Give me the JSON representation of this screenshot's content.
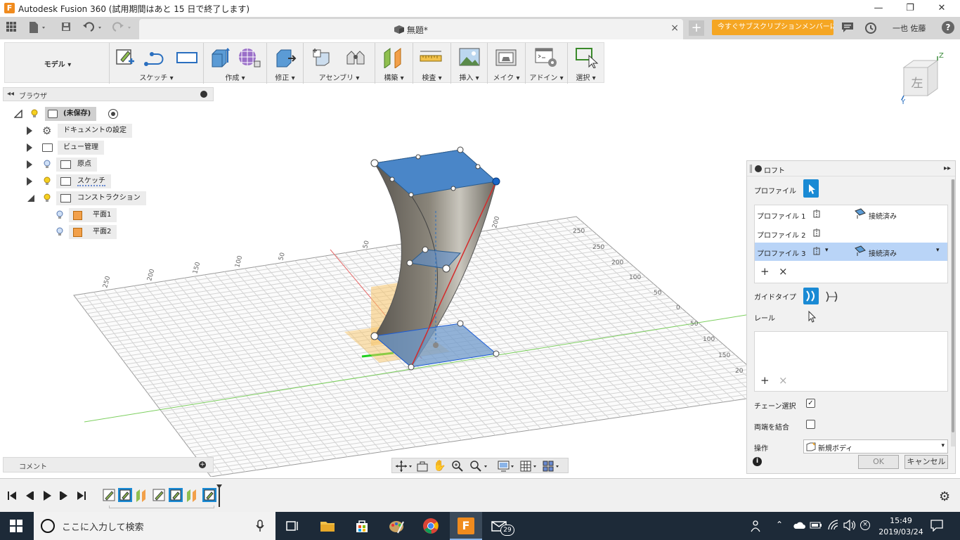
{
  "window": {
    "title": "Autodesk Fusion 360 (試用期間はあと 15 日で終了します)",
    "controls": [
      "—",
      "❐",
      "✕"
    ]
  },
  "tabbar": {
    "doc_title": "無題*",
    "close_glyph": "×",
    "new_tab_glyph": "+",
    "subscription_button": "今すぐサブスクリプションメンバーに...",
    "user_name": "一也 佐藤",
    "help_glyph": "?"
  },
  "toolbar": {
    "mode": "モデル",
    "groups": [
      {
        "label": "スケッチ"
      },
      {
        "label": "作成"
      },
      {
        "label": "修正"
      },
      {
        "label": "アセンブリ"
      },
      {
        "label": "構築"
      },
      {
        "label": "検査"
      },
      {
        "label": "挿入"
      },
      {
        "label": "メイク"
      },
      {
        "label": "アドイン"
      },
      {
        "label": "選択"
      }
    ]
  },
  "viewcube": {
    "face_label": "左",
    "axis_z": "Z",
    "axis_y": "Y"
  },
  "browser": {
    "title": "ブラウザ",
    "items": [
      {
        "label": "(未保存)"
      },
      {
        "label": "ドキュメントの設定"
      },
      {
        "label": "ビュー管理"
      },
      {
        "label": "原点"
      },
      {
        "label": "スケッチ"
      },
      {
        "label": "コンストラクション"
      },
      {
        "label": "平面1"
      },
      {
        "label": "平面2"
      }
    ]
  },
  "comments": {
    "title": "コメント"
  },
  "grid_labels": [
    "250",
    "200",
    "150",
    "100",
    "50",
    "50",
    "100",
    "150",
    "200",
    "250",
    "100",
    "50",
    "0",
    "50",
    "100",
    "150",
    "20"
  ],
  "loft": {
    "title": "ロフト",
    "profile_label": "プロファイル",
    "profiles": [
      {
        "name": "プロファイル 1",
        "status": "接続済み"
      },
      {
        "name": "プロファイル 2",
        "status": ""
      },
      {
        "name": "プロファイル 3",
        "status": "接続済み"
      }
    ],
    "add_glyph": "+",
    "remove_glyph": "×",
    "guide_type_label": "ガイドタイプ",
    "rail_label": "レール",
    "chain_select_label": "チェーン選択",
    "chain_select_checked": true,
    "close_both_ends_label": "両端を結合",
    "close_both_ends_checked": false,
    "operation_label": "操作",
    "operation_value": "新規ボディ",
    "ok_label": "OK",
    "cancel_label": "キャンセル",
    "info_glyph": "i"
  },
  "taskbar": {
    "search_placeholder": "ここに入力して検索",
    "mail_badge": "29",
    "time": "15:49",
    "date": "2019/03/24"
  },
  "colors": {
    "accent_blue": "#1a8ad4",
    "subscription_orange": "#f5a623",
    "fusion_orange": "#f08b1e",
    "taskbar": "#1d2a38"
  }
}
